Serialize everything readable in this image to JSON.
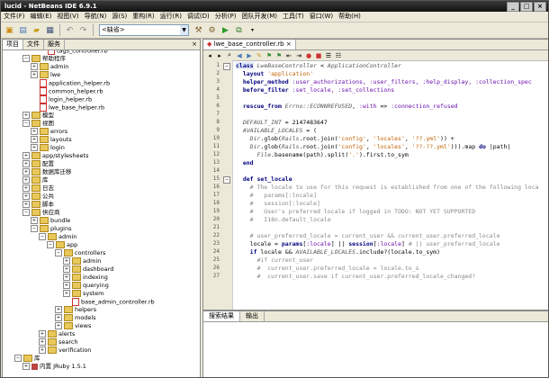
{
  "window": {
    "title": "lucid - NetBeans IDE 6.9.1"
  },
  "menu": [
    "文件(F)",
    "编辑(E)",
    "视图(V)",
    "导航(N)",
    "源(S)",
    "重构(R)",
    "运行(R)",
    "调试(D)",
    "分析(P)",
    "团队开发(M)",
    "工具(T)",
    "窗口(W)",
    "帮助(H)"
  ],
  "toolbar": {
    "config_value": "<缺省>"
  },
  "left_panel": {
    "tabs": [
      "项目",
      "文件",
      "服务"
    ],
    "tree": [
      {
        "label": "tags_controller.rb",
        "type": "file",
        "depth": 4,
        "toggle": ""
      },
      {
        "label": "帮助程序",
        "type": "folder",
        "depth": 2,
        "toggle": "−"
      },
      {
        "label": "admin",
        "type": "folder",
        "depth": 3,
        "toggle": "+"
      },
      {
        "label": "lwe",
        "type": "folder",
        "depth": 3,
        "toggle": "+"
      },
      {
        "label": "application_helper.rb",
        "type": "file",
        "depth": 3,
        "toggle": ""
      },
      {
        "label": "common_helper.rb",
        "type": "file",
        "depth": 3,
        "toggle": ""
      },
      {
        "label": "login_helper.rb",
        "type": "file",
        "depth": 3,
        "toggle": ""
      },
      {
        "label": "lwe_base_helper.rb",
        "type": "file",
        "depth": 3,
        "toggle": ""
      },
      {
        "label": "模型",
        "type": "folder",
        "depth": 2,
        "toggle": "+"
      },
      {
        "label": "视图",
        "type": "folder",
        "depth": 2,
        "toggle": "−"
      },
      {
        "label": "errors",
        "type": "folder",
        "depth": 3,
        "toggle": "+"
      },
      {
        "label": "layouts",
        "type": "folder",
        "depth": 3,
        "toggle": "+"
      },
      {
        "label": "login",
        "type": "folder",
        "depth": 3,
        "toggle": "+"
      },
      {
        "label": "app/stylesheets",
        "type": "folder",
        "depth": 2,
        "toggle": "+"
      },
      {
        "label": "配置",
        "type": "folder",
        "depth": 2,
        "toggle": "+"
      },
      {
        "label": "数据库迁移",
        "type": "folder",
        "depth": 2,
        "toggle": "+"
      },
      {
        "label": "库",
        "type": "folder",
        "depth": 2,
        "toggle": "+"
      },
      {
        "label": "日志",
        "type": "folder",
        "depth": 2,
        "toggle": "+"
      },
      {
        "label": "公共",
        "type": "folder",
        "depth": 2,
        "toggle": "+"
      },
      {
        "label": "脚本",
        "type": "folder",
        "depth": 2,
        "toggle": "+"
      },
      {
        "label": "供应商",
        "type": "folder",
        "depth": 2,
        "toggle": "−"
      },
      {
        "label": "bundle",
        "type": "folder",
        "depth": 3,
        "toggle": "+"
      },
      {
        "label": "plugins",
        "type": "folder",
        "depth": 3,
        "toggle": "−"
      },
      {
        "label": "admin",
        "type": "folder",
        "depth": 4,
        "toggle": "−"
      },
      {
        "label": "app",
        "type": "folder",
        "depth": 5,
        "toggle": "−"
      },
      {
        "label": "controllers",
        "type": "folder",
        "depth": 6,
        "toggle": "−"
      },
      {
        "label": "admin",
        "type": "folder",
        "depth": 7,
        "toggle": "+"
      },
      {
        "label": "dashboard",
        "type": "folder",
        "depth": 7,
        "toggle": "+"
      },
      {
        "label": "indexing",
        "type": "folder",
        "depth": 7,
        "toggle": "+"
      },
      {
        "label": "querying",
        "type": "folder",
        "depth": 7,
        "toggle": "+"
      },
      {
        "label": "system",
        "type": "folder",
        "depth": 7,
        "toggle": "+"
      },
      {
        "label": "base_admin_controller.rb",
        "type": "file",
        "depth": 7,
        "toggle": ""
      },
      {
        "label": "helpers",
        "type": "folder",
        "depth": 6,
        "toggle": "+"
      },
      {
        "label": "models",
        "type": "folder",
        "depth": 6,
        "toggle": "+"
      },
      {
        "label": "views",
        "type": "folder",
        "depth": 6,
        "toggle": "+"
      },
      {
        "label": "alerts",
        "type": "folder",
        "depth": 4,
        "toggle": "+"
      },
      {
        "label": "search",
        "type": "folder",
        "depth": 4,
        "toggle": "+"
      },
      {
        "label": "verification",
        "type": "folder",
        "depth": 4,
        "toggle": "+"
      },
      {
        "label": "库",
        "type": "folder",
        "depth": 1,
        "toggle": "−"
      },
      {
        "label": "内置 JRuby 1.5.1",
        "type": "pkg",
        "depth": 2,
        "toggle": "+"
      }
    ]
  },
  "editor": {
    "tab": "lwe_base_controller.rb",
    "lines": [
      {
        "n": "1",
        "fold": "−",
        "html": "<span class=\"kw cur\">class</span> <span class=\"it\">LweBaseController</span> &lt; <span class=\"it\">ApplicationController</span>"
      },
      {
        "n": "2",
        "fold": "",
        "html": "  <span class=\"kw\">layout</span> <span class=\"str\">'application'</span>"
      },
      {
        "n": "3",
        "fold": "",
        "html": "  <span class=\"kw\">helper_method</span> <span class=\"sym\">:user_authorizations, :user_filters, :help_display, :collection_spec</span>"
      },
      {
        "n": "4",
        "fold": "",
        "html": "  <span class=\"kw\">before_filter</span> <span class=\"sym\">:set_locale, :set_collections</span>"
      },
      {
        "n": "5",
        "fold": "",
        "html": ""
      },
      {
        "n": "6",
        "fold": "",
        "html": "  <span class=\"kw\">rescue_from</span> <span class=\"it\">Errno::ECONNREFUSED</span>, <span class=\"sym\">:with</span> =&gt; <span class=\"sym\">:connection_refused</span>"
      },
      {
        "n": "7",
        "fold": "",
        "html": ""
      },
      {
        "n": "8",
        "fold": "",
        "html": "  <span class=\"it\">DEFAULT_INT</span> = 2147483647"
      },
      {
        "n": "9",
        "fold": "",
        "html": "  <span class=\"it\">AVAILABLE_LOCALES</span> = ("
      },
      {
        "n": "10",
        "fold": "",
        "html": "    <span class=\"it\">Dir</span>.glob(<span class=\"it\">Rails</span>.root.join(<span class=\"str\">'config'</span>, <span class=\"str\">'locales'</span>, <span class=\"str\">'??.yml'</span>)) +"
      },
      {
        "n": "11",
        "fold": "",
        "html": "    <span class=\"it\">Dir</span>.glob(<span class=\"it\">Rails</span>.root.join(<span class=\"str\">'config'</span>, <span class=\"str\">'locales'</span>, <span class=\"str\">'??-??.yml'</span>))).map <span class=\"kw\">do</span> |path|"
      },
      {
        "n": "12",
        "fold": "",
        "html": "      <span class=\"it\">File</span>.basename(path).split(<span class=\"str\">'.'</span>).first.to_sym"
      },
      {
        "n": "13",
        "fold": "",
        "html": "  <span class=\"kw\">end</span>"
      },
      {
        "n": "14",
        "fold": "",
        "html": ""
      },
      {
        "n": "15",
        "fold": "−",
        "html": "  <span class=\"kw\">def</span> <span class=\"kw\">set_locale</span>"
      },
      {
        "n": "16",
        "fold": "",
        "html": "    <span class=\"cm\"># The locale to use for this request is established from one of the following loca</span>"
      },
      {
        "n": "17",
        "fold": "",
        "html": "    <span class=\"cm\">#   params[:locale]</span>"
      },
      {
        "n": "18",
        "fold": "",
        "html": "    <span class=\"cm\">#   session[:locale]</span>"
      },
      {
        "n": "19",
        "fold": "",
        "html": "    <span class=\"cm\">#   User's preferred locale if logged in TODO: NOT YET SUPPORTED</span>"
      },
      {
        "n": "20",
        "fold": "",
        "html": "    <span class=\"cm\">#   I18n.default_locale</span>"
      },
      {
        "n": "21",
        "fold": "",
        "html": ""
      },
      {
        "n": "22",
        "fold": "",
        "html": "    <span class=\"cm\"># user_preferred_locale = current_user &amp;&amp; current_user.preferred_locale</span>"
      },
      {
        "n": "23",
        "fold": "",
        "html": "    locale = <span class=\"kw\">params</span>[<span class=\"sym\">:locale</span>] || <span class=\"kw\">session</span>[<span class=\"sym\">:locale</span>] <span class=\"cm\"># || user_preferred_locale</span>"
      },
      {
        "n": "24",
        "fold": "",
        "html": "    <span class=\"kw\">if</span> locale &amp;&amp; <span class=\"it\">AVAILABLE_LOCALES</span>.include?(locale.to_sym)"
      },
      {
        "n": "25",
        "fold": "",
        "html": "      <span class=\"cm\">#if current_user</span>"
      },
      {
        "n": "26",
        "fold": "",
        "html": "      <span class=\"cm\">#  current_user.preferred_locale = locale.to_s</span>"
      },
      {
        "n": "27",
        "fold": "",
        "html": "      <span class=\"cm\">#  current_user.save if current_user.preferred_locale_changed?</span>"
      }
    ]
  },
  "bottom_panel": {
    "tabs": [
      "搜索结果",
      "输出"
    ]
  }
}
